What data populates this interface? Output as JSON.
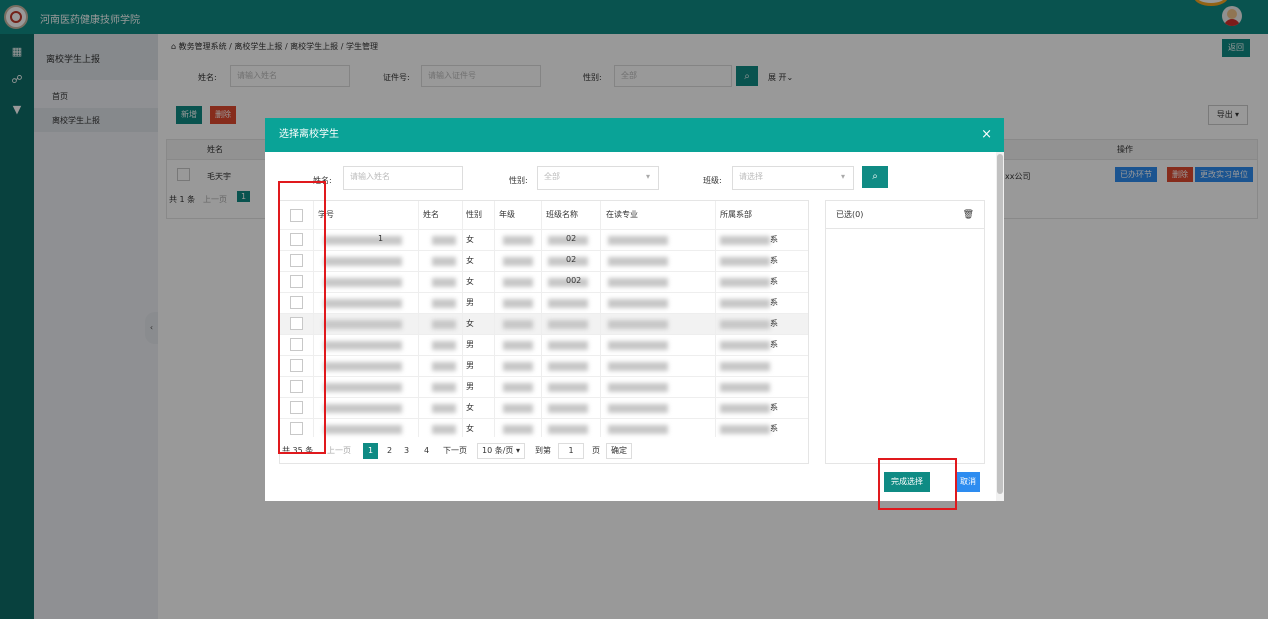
{
  "app": {
    "title": "河南医药健康技师学院"
  },
  "sidebar": {
    "header": "离校学生上报",
    "items": [
      {
        "label": "首页"
      },
      {
        "label": "离校学生上报"
      }
    ]
  },
  "breadcrumb": {
    "home_icon": "home-icon",
    "path": "教务管理系统 / 离校学生上报 / 离校学生上报 / 学生管理",
    "back_label": "返回"
  },
  "filters": {
    "name_label": "姓名:",
    "name_placeholder": "请输入姓名",
    "id_label": "证件号:",
    "id_placeholder": "请输入证件号",
    "gender_label": "性别:",
    "gender_value": "全部",
    "expand_label": "展 开⌄"
  },
  "toolbar": {
    "add_label": "新增",
    "delete_label": "删除",
    "export_label": "导出 ▾"
  },
  "bg_table": {
    "headers": {
      "name": "姓名",
      "ops": "操作"
    },
    "row": {
      "name": "毛天宇",
      "company": "xx公司",
      "op1": "已办环节",
      "op2": "删除",
      "op3": "更改实习单位"
    },
    "footer": {
      "total": "共 1 条",
      "prev": "上一页",
      "page": "1"
    }
  },
  "dialog": {
    "title": "选择离校学生",
    "close": "×",
    "filters": {
      "name_label": "姓名:",
      "name_placeholder": "请输入姓名",
      "gender_label": "性别:",
      "gender_value": "全部",
      "class_label": "班级:",
      "class_placeholder": "请选择"
    },
    "columns": [
      "学号",
      "姓名",
      "性别",
      "年级",
      "班级名称",
      "在读专业",
      "所属系部"
    ],
    "rows": [
      {
        "id_tail": "1",
        "name_tail": "",
        "gender": "女",
        "class_tail": "02",
        "dept_tail": "系"
      },
      {
        "id_tail": "",
        "name_tail": "",
        "gender": "女",
        "class_tail": "02",
        "dept_tail": "系"
      },
      {
        "id_tail": "",
        "name_tail": "",
        "gender": "女",
        "class_tail": "002",
        "dept_tail": "系"
      },
      {
        "id_tail": "",
        "name_tail": "",
        "gender": "男",
        "class_tail": "",
        "dept_tail": "系"
      },
      {
        "id_tail": "",
        "name_tail": "",
        "gender": "女",
        "class_tail": "",
        "dept_tail": "系"
      },
      {
        "id_tail": "",
        "name_tail": "",
        "gender": "男",
        "class_tail": "",
        "dept_tail": "系"
      },
      {
        "id_tail": "",
        "name_tail": "",
        "gender": "男",
        "class_tail": "",
        "dept_tail": ""
      },
      {
        "id_tail": "",
        "name_tail": "",
        "gender": "男",
        "class_tail": "",
        "dept_tail": ""
      },
      {
        "id_tail": "",
        "name_tail": "",
        "gender": "女",
        "class_tail": "",
        "dept_tail": "系"
      },
      {
        "id_tail": "",
        "name_tail": "",
        "gender": "女",
        "class_tail": "",
        "dept_tail": "系"
      }
    ],
    "pager": {
      "total": "共 35 条",
      "prev": "上一页",
      "pages": [
        "1",
        "2",
        "3",
        "4"
      ],
      "next": "下一页",
      "page_size": "10 条/页 ▾",
      "goto_label": "到第",
      "goto_value": "1",
      "page_unit": "页",
      "confirm": "确定"
    },
    "selected": {
      "title": "已选(0)"
    },
    "confirm_label": "完成选择",
    "cancel_label": "取消"
  },
  "colors": {
    "primary": "#0f8b84",
    "header": "#0aa397",
    "danger": "#e04a2f",
    "info": "#2d8cf0",
    "annotation": "#e0191d"
  }
}
